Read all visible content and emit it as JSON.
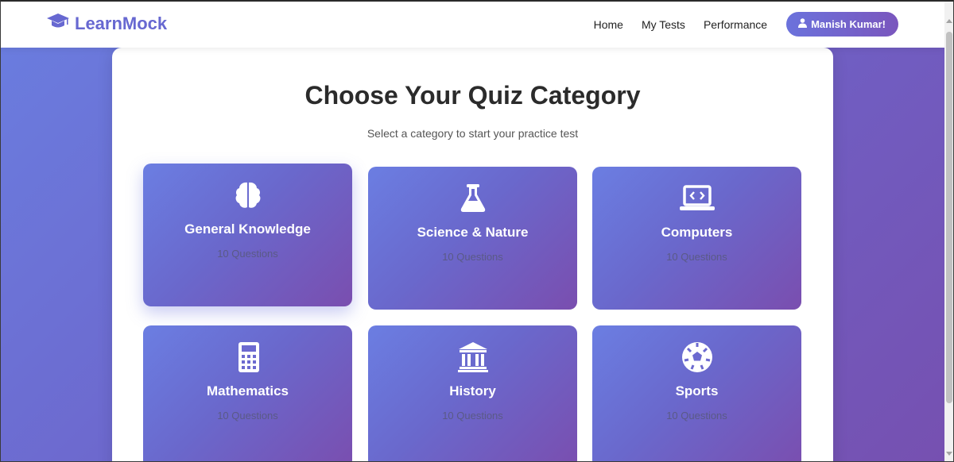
{
  "navbar": {
    "brand_name": "LearnMock",
    "brand_icon": "graduation-cap-icon",
    "links": [
      {
        "label": "Home"
      },
      {
        "label": "My Tests"
      },
      {
        "label": "Performance"
      }
    ],
    "user_button_label": "Manish Kumar!",
    "user_icon": "user-icon"
  },
  "main": {
    "title": "Choose Your Quiz Category",
    "subtitle": "Select a category to start your practice test",
    "categories": [
      {
        "name": "General Knowledge",
        "count": "10 Questions",
        "icon": "brain-icon"
      },
      {
        "name": "Science & Nature",
        "count": "10 Questions",
        "icon": "flask-icon"
      },
      {
        "name": "Computers",
        "count": "10 Questions",
        "icon": "laptop-code-icon"
      },
      {
        "name": "Mathematics",
        "count": "10 Questions",
        "icon": "calculator-icon"
      },
      {
        "name": "History",
        "count": "10 Questions",
        "icon": "landmark-icon"
      },
      {
        "name": "Sports",
        "count": "10 Questions",
        "icon": "soccer-ball-icon"
      }
    ]
  },
  "colors": {
    "brand": "#6768d1",
    "gradient_start": "#6b7ee2",
    "gradient_end": "#7a4eaf"
  }
}
